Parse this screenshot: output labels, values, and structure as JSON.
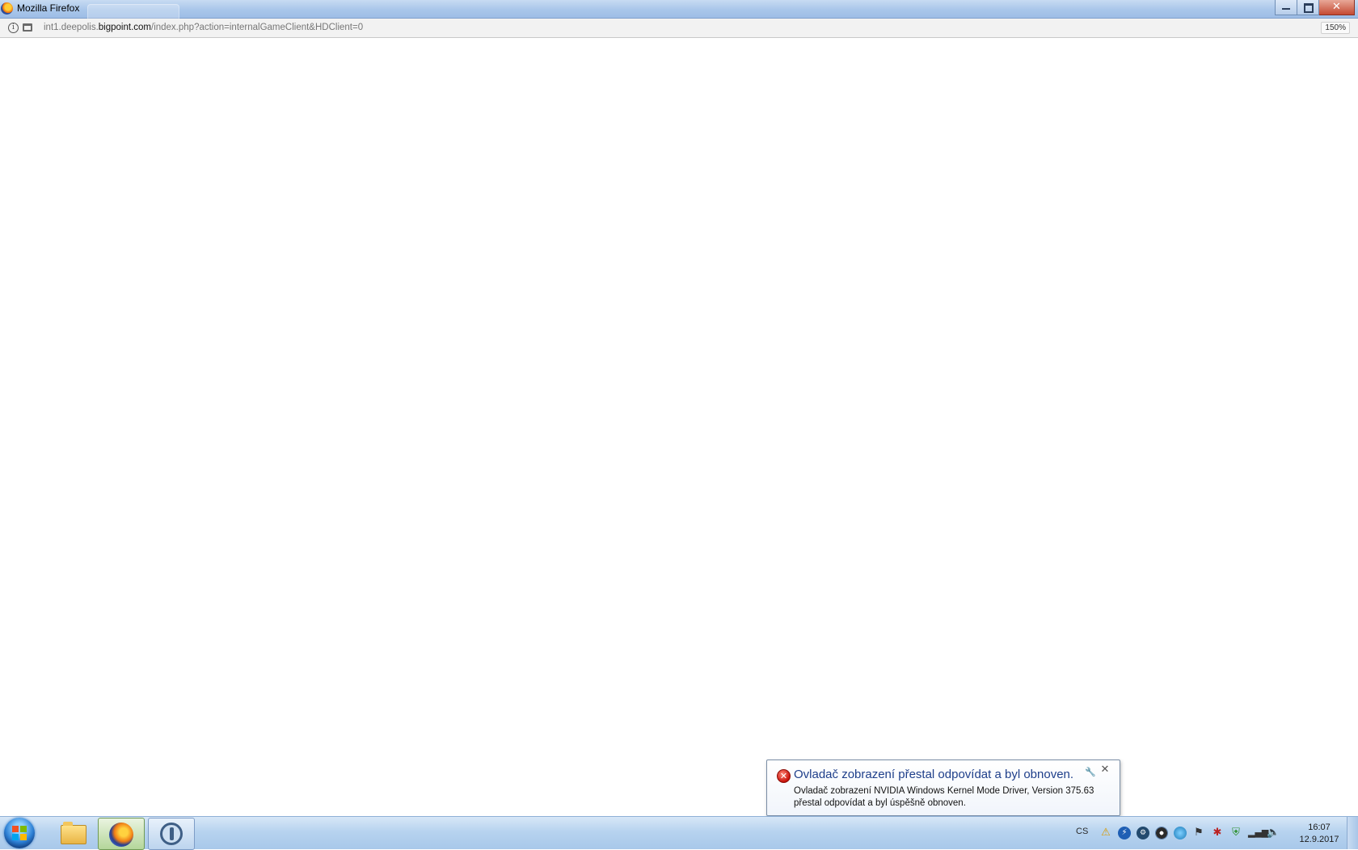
{
  "window": {
    "title": "Mozilla Firefox"
  },
  "address_bar": {
    "url_prefix": "int1.deepolis.",
    "url_host": "bigpoint.com",
    "url_path": "/index.php?action=internalGameClient&HDClient=0",
    "zoom": "150%"
  },
  "notification": {
    "title": "Ovladač zobrazení přestal odpovídat a byl obnoven.",
    "body": "Ovladač zobrazení NVIDIA Windows Kernel Mode Driver, Version 375.63 přestal odpovídat a byl úspěšně obnoven.",
    "close_glyph": "✕",
    "icon": "error-icon"
  },
  "taskbar": {
    "language": "CS",
    "clock_time": "16:07",
    "clock_date": "12.9.2017",
    "pinned": [
      "windows-explorer",
      "firefox",
      "teamspeak"
    ],
    "tray_icons": [
      "warning",
      "flash",
      "steam",
      "disc",
      "globe",
      "flag",
      "bug",
      "shield",
      "signal",
      "volume"
    ]
  }
}
